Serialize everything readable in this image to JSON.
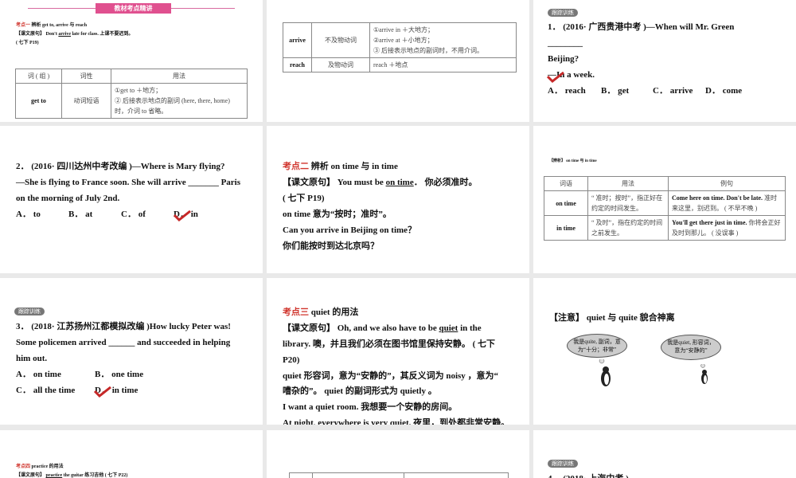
{
  "slide1": {
    "banner": "教材考点精讲",
    "point_label": "考点一",
    "point_title": "辨析 get to, arrive 与 reach",
    "source_label": "【课文原句】",
    "source_pre": "Don't ",
    "source_underlined": "arrive",
    "source_post": " late for class. 上课不要迟到。",
    "ref": "( 七下 P19)",
    "headers": [
      "词 ( 组 )",
      "词性",
      "用法"
    ],
    "row": {
      "word": "get to",
      "pos": "动词短语",
      "usage": [
        "①get to ＋地方；",
        "② 后接表示地点的副词 (here, there, home)",
        "时，介词 to 省略。"
      ]
    }
  },
  "slide2": {
    "rows": [
      {
        "word": "arrive",
        "pos": "不及物动词",
        "usage": [
          "①arrive in ＋大地方；",
          "②arrive at ＋小地方；",
          "③ 后接表示地点的副词时，不用介词。"
        ]
      },
      {
        "word": "reach",
        "pos": "及物动词",
        "usage": [
          "reach ＋地点"
        ]
      }
    ]
  },
  "slide3": {
    "badge": "跟踪训练",
    "q": "1． (2016· 广西贵港中考 )—When will Mr. Green",
    "blank": "________",
    "q2": "Beijing?",
    "answer": "—In a week.",
    "options": [
      "A． reach",
      "B． get",
      "C． arrive",
      "D． come"
    ]
  },
  "slide4": {
    "lines": [
      "2． (2016· 四川达州中考改编 )—Where is Mary flying?",
      "—She is flying to France soon. She will arrive _______ Paris",
      "on the morning of July 2nd."
    ],
    "options": [
      "A． to",
      "B． at",
      "C． of",
      "D． in"
    ]
  },
  "slide5": {
    "point_label": "考点二",
    "point_title": "辨析 on time 与 in time",
    "source_label": "【课文原句】",
    "source_pre": "You must be ",
    "source_underlined": "on time",
    "source_post": "． 你必须准时。",
    "lines": [
      "( 七下 P19)",
      "on time 意为“按时；准时”。",
      "Can you arrive in Beijing on time？",
      "你们能按时到达北京吗？"
    ]
  },
  "slide6": {
    "label": "【辨析】",
    "title": "on time 与 in time",
    "headers": [
      "词语",
      "用法",
      "例句"
    ],
    "rows": [
      {
        "word": "on time",
        "usage": "“ 准时；按时”，指正好在约定的时间发生。",
        "example_en": "Come here on time. Don't be late.",
        "example_zh": " 准时来这里，别迟到。 ( 不早不晚 )"
      },
      {
        "word": "in time",
        "usage": "“ 及时”，指在约定的时间之前发生。",
        "example_en": "You'll get there just in time.",
        "example_zh": " 你将会正好及时到那儿。 ( 没误事 )"
      }
    ]
  },
  "slide7": {
    "badge": "跟踪训练",
    "lines": [
      "3． (2018· 江苏扬州江都模拟改编 )How lucky Peter was!",
      "Some policemen arrived ______ and succeeded in helping",
      "him out."
    ],
    "options": [
      "A． on time",
      "B． one time",
      "C． all the time",
      "D． in time"
    ]
  },
  "slide8": {
    "point_label": "考点三",
    "point_title": "quiet 的用法",
    "source_label": "【课文原句】",
    "source_pre": "Oh, and we also have to be ",
    "source_underlined": "quiet",
    "source_post": " in the",
    "lines": [
      "library. 噢，并且我们必须在图书馆里保持安静。 ( 七下",
      "P20)",
      "quiet 形容词，意为“安静的”，其反义词为 noisy ，意为“",
      "嘈杂的”。  quiet 的副词形式为 quietly 。",
      "I want a quiet room. 我想要一个安静的房间。",
      "At night, everywhere is very quiet. 夜里，到处都非常安静。"
    ]
  },
  "slide9": {
    "label": "【注意】",
    "title": "quiet 与 quite  貌合神离",
    "bubble1": "我是quite, 副词，意为“十分；非常”",
    "bubble2": "我是quiet, 形容词，意为“安静的”"
  },
  "slide10": {
    "point_label": "考点四",
    "point_title": "practice 的用法",
    "source_label": "【课文原句】",
    "source_underlined": "practice",
    "source_post": " the guitar 练习吉他 ( 七下 P22)"
  },
  "slide12": {
    "badge": "跟踪训练",
    "q": "4． (2018· 上海中考 )"
  }
}
